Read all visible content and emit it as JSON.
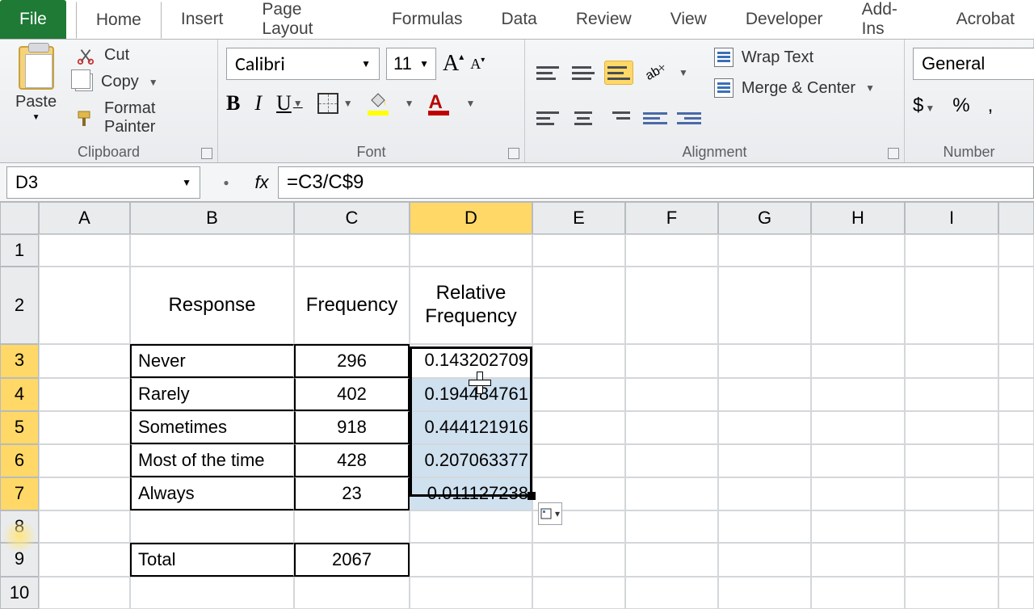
{
  "tabs": {
    "file": "File",
    "items": [
      "Home",
      "Insert",
      "Page Layout",
      "Formulas",
      "Data",
      "Review",
      "View",
      "Developer",
      "Add-Ins",
      "Acrobat"
    ],
    "active": "Home"
  },
  "ribbon": {
    "clipboard": {
      "title": "Clipboard",
      "paste": "Paste",
      "cut": "Cut",
      "copy": "Copy",
      "format_painter": "Format Painter"
    },
    "font": {
      "title": "Font",
      "name": "Calibri",
      "size": "11"
    },
    "alignment": {
      "title": "Alignment",
      "wrap": "Wrap Text",
      "merge": "Merge & Center"
    },
    "number": {
      "title": "Number",
      "format": "General"
    }
  },
  "formula_bar": {
    "name_box": "D3",
    "formula": "=C3/C$9"
  },
  "columns": [
    "A",
    "B",
    "C",
    "D",
    "E",
    "F",
    "G",
    "H",
    "I"
  ],
  "rows": [
    "1",
    "2",
    "3",
    "4",
    "5",
    "6",
    "7",
    "8",
    "9",
    "10"
  ],
  "table": {
    "h_response": "Response",
    "h_frequency": "Frequency",
    "h_relfreq": "Relative Frequency",
    "rows": [
      {
        "response": "Never",
        "freq": "296",
        "rf": "0.143202709"
      },
      {
        "response": "Rarely",
        "freq": "402",
        "rf": "0.194484761"
      },
      {
        "response": "Sometimes",
        "freq": "918",
        "rf": "0.444121916"
      },
      {
        "response": "Most of the time",
        "freq": "428",
        "rf": "0.207063377"
      },
      {
        "response": "Always",
        "freq": "23",
        "rf": "0.011127238"
      }
    ],
    "total_label": "Total",
    "total_value": "2067"
  },
  "chart_data": {
    "type": "table",
    "title": "Relative Frequency",
    "columns": [
      "Response",
      "Frequency",
      "Relative Frequency"
    ],
    "rows": [
      [
        "Never",
        296,
        0.143202709
      ],
      [
        "Rarely",
        402,
        0.194484761
      ],
      [
        "Sometimes",
        918,
        0.444121916
      ],
      [
        "Most of the time",
        428,
        0.207063377
      ],
      [
        "Always",
        23,
        0.011127238
      ]
    ],
    "total": 2067
  }
}
